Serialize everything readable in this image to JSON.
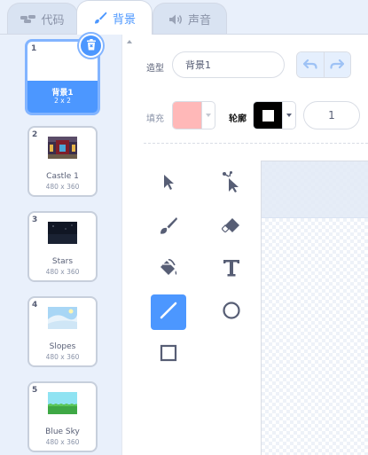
{
  "tabs": [
    {
      "label": "代码",
      "icon": "code-icon",
      "active": false
    },
    {
      "label": "背景",
      "icon": "brush-icon",
      "active": true
    },
    {
      "label": "声音",
      "icon": "speaker-icon",
      "active": false
    }
  ],
  "costumes": [
    {
      "number": "1",
      "name": "背景1",
      "size": "2 x 2",
      "selected": true
    },
    {
      "number": "2",
      "name": "Castle 1",
      "size": "480 x 360",
      "selected": false
    },
    {
      "number": "3",
      "name": "Stars",
      "size": "480 x 360",
      "selected": false
    },
    {
      "number": "4",
      "name": "Slopes",
      "size": "480 x 360",
      "selected": false
    },
    {
      "number": "5",
      "name": "Blue Sky",
      "size": "480 x 360",
      "selected": false
    }
  ],
  "editor": {
    "costume_label": "造型",
    "costume_name": "背景1",
    "fill_label": "填充",
    "outline_label": "轮廓",
    "outline_width": "1",
    "fill_color": "#ffb8b8",
    "outline_color": "#000000"
  },
  "tools": [
    {
      "name": "select-tool",
      "icon": "arrow-icon"
    },
    {
      "name": "reshape-tool",
      "icon": "reshape-icon"
    },
    {
      "name": "brush-tool",
      "icon": "brush-icon"
    },
    {
      "name": "eraser-tool",
      "icon": "eraser-icon"
    },
    {
      "name": "fill-tool",
      "icon": "bucket-icon"
    },
    {
      "name": "text-tool",
      "icon": "text-icon"
    },
    {
      "name": "line-tool",
      "icon": "line-icon",
      "active": true
    },
    {
      "name": "circle-tool",
      "icon": "circle-icon"
    },
    {
      "name": "rectangle-tool",
      "icon": "rectangle-icon"
    }
  ],
  "colors": {
    "accent": "#4c97ff",
    "background": "#e9f0fb",
    "text": "#575e75"
  }
}
